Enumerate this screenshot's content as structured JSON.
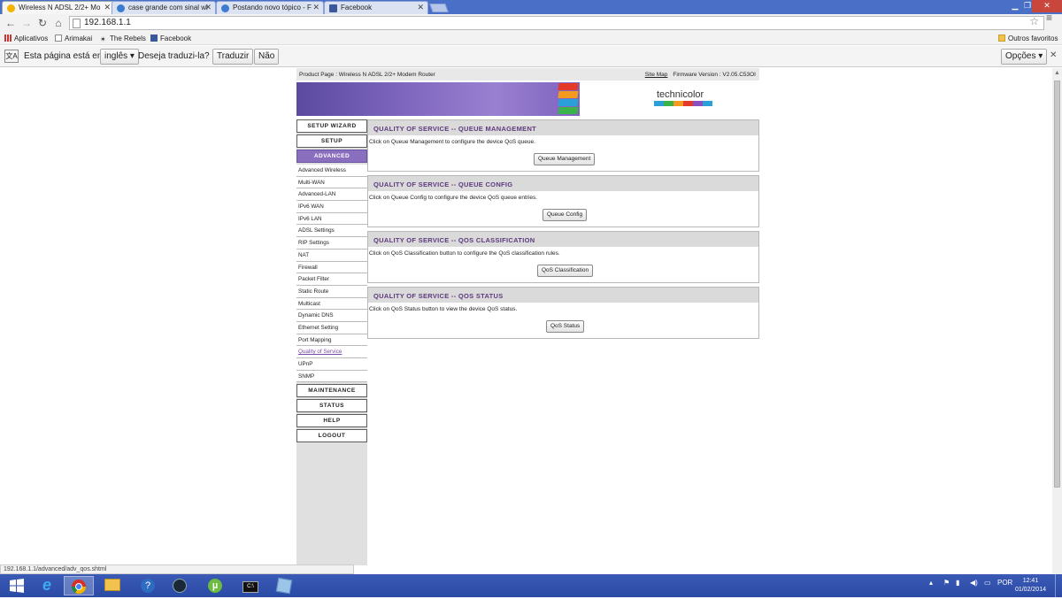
{
  "browser": {
    "tabs": [
      {
        "label": "Wireless N ADSL 2/2+ Mo",
        "active": true
      },
      {
        "label": "case grande com sinal wi",
        "active": false
      },
      {
        "label": "Postando novo tópico - F",
        "active": false
      },
      {
        "label": "Facebook",
        "active": false
      }
    ],
    "url": "192.168.1.1",
    "bookmarks": {
      "apps": "Aplicativos",
      "b1": "Arimakai",
      "b2": "The Rebels",
      "b3": "Facebook",
      "other": "Outros favoritos"
    },
    "translate": {
      "prefix": "Esta página está em",
      "lang": "inglês",
      "question": "Deseja traduzi-la?",
      "translate_btn": "Traduzir",
      "no_btn": "Não",
      "options_btn": "Opções"
    },
    "status_url": "192.168.1.1/advanced/adv_qos.shtml"
  },
  "router": {
    "product": "Product Page : Wireless N ADSL 2/2+ Modem Router",
    "site_map": "Site Map",
    "firmware": "Firmware Version : V2.05.C53OI",
    "brand": "technicolor",
    "nav": {
      "setup_wizard": "SETUP WIZARD",
      "setup": "SETUP",
      "advanced": "ADVANCED",
      "links": [
        "Advanced Wireless",
        "Multi-WAN",
        "Advanced-LAN",
        "IPv6 WAN",
        "IPv6 LAN",
        "ADSL Settings",
        "RIP Settings",
        "NAT",
        "Firewall",
        "Packet Filter",
        "Static Route",
        "Multicast",
        "Dynamic DNS",
        "Ethernet Setting",
        "Port Mapping",
        "Quality of Service",
        "UPnP",
        "SNMP"
      ],
      "maintenance": "MAINTENANCE",
      "status": "STATUS",
      "help": "HELP",
      "logout": "LOGOUT"
    },
    "sections": [
      {
        "title": "QUALITY OF SERVICE -- QUEUE MANAGEMENT",
        "desc": "Click on Queue Management to configure the device QoS queue.",
        "button": "Queue Management"
      },
      {
        "title": "QUALITY OF SERVICE -- QUEUE CONFIG",
        "desc": "Click on Queue Config to configure the device QoS queue entries.",
        "button": "Queue Config"
      },
      {
        "title": "QUALITY OF SERVICE -- QOS CLASSIFICATION",
        "desc": "Click on QoS Classification button to configure the QoS classification rules.",
        "button": "QoS Classification"
      },
      {
        "title": "QUALITY OF SERVICE -- QOS STATUS",
        "desc": "Click on QoS Status button to view the device QoS status.",
        "button": "QoS Status"
      }
    ]
  },
  "taskbar": {
    "lang": "POR",
    "time": "12:41",
    "date": "01/02/2014"
  },
  "colors": {
    "accent_purple": "#8a6fbf",
    "header_text": "#5e3a7e",
    "taskbar": "#2b4aa5"
  }
}
